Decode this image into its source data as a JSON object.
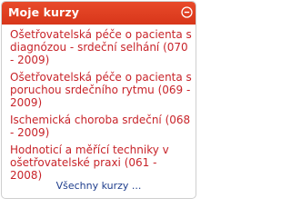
{
  "block": {
    "title": "Moje kurzy",
    "toggle_icon": "collapse-icon",
    "header_color": "#e04022",
    "link_color": "#c8242a"
  },
  "courses": [
    {
      "label": "Ošetřovatelská péče o pacienta s diagnózou - srdeční selhání (070 - 2009)"
    },
    {
      "label": "Ošetřovatelská péče o pacienta s poruchou srdečního rytmu (069 - 2009)"
    },
    {
      "label": "Ischemická choroba srdeční (068 - 2009)"
    },
    {
      "label": "Hodnoticí a měřící techniky v ošetřovatelské praxi (061 - 2008)"
    }
  ],
  "footer": {
    "all_courses_label": "Všechny kurzy ..."
  }
}
